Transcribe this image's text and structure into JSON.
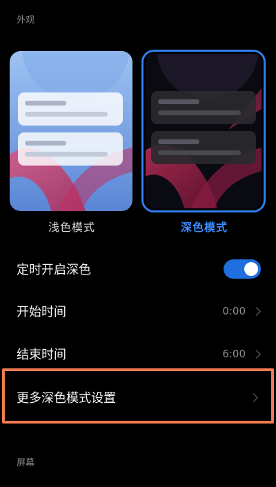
{
  "appearance_section": {
    "title": "外观"
  },
  "theme": {
    "light_label": "浅色模式",
    "dark_label": "深色模式",
    "selected": "dark"
  },
  "settings": {
    "schedule_dark": {
      "label": "定时开启深色",
      "enabled": true
    },
    "start_time": {
      "label": "开始时间",
      "value": "0:00"
    },
    "end_time": {
      "label": "结束时间",
      "value": "6:00"
    },
    "more_dark_settings": {
      "label": "更多深色模式设置"
    }
  },
  "screen_section": {
    "title": "屏幕"
  },
  "colors": {
    "accent": "#2f7ff0",
    "highlight_border": "#f07a4f",
    "background": "#000000"
  }
}
